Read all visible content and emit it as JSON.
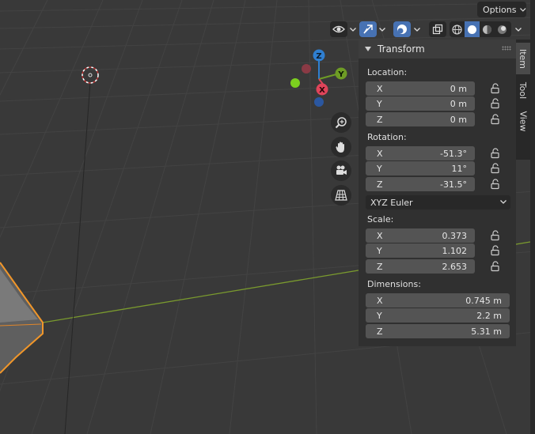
{
  "header": {
    "options_label": "Options",
    "icons": [
      "eye-visibility-icon",
      "gizmo-arrow-icon",
      "overlay-icon",
      "xray-toggle-icon",
      "shading-wireframe-icon",
      "shading-solid-icon",
      "shading-material-icon",
      "shading-rendered-icon"
    ]
  },
  "gizmo": {
    "z_label": "Z",
    "y_label": "Y",
    "x_label": "X",
    "colors": {
      "x": "#e0445a",
      "y": "#6e9c25",
      "z": "#2f7fd1"
    }
  },
  "nav_buttons": [
    "zoom-icon",
    "pan-hand-icon",
    "camera-icon",
    "grid-perspective-icon"
  ],
  "transform": {
    "title": "Transform",
    "location": {
      "label": "Location:",
      "x": {
        "axis": "X",
        "value": "0 m"
      },
      "y": {
        "axis": "Y",
        "value": "0 m"
      },
      "z": {
        "axis": "Z",
        "value": "0 m"
      }
    },
    "rotation": {
      "label": "Rotation:",
      "x": {
        "axis": "X",
        "value": "-51.3°"
      },
      "y": {
        "axis": "Y",
        "value": "11°"
      },
      "z": {
        "axis": "Z",
        "value": "-31.5°"
      },
      "mode": "XYZ Euler"
    },
    "scale": {
      "label": "Scale:",
      "x": {
        "axis": "X",
        "value": "0.373"
      },
      "y": {
        "axis": "Y",
        "value": "1.102"
      },
      "z": {
        "axis": "Z",
        "value": "2.653"
      }
    },
    "dimensions": {
      "label": "Dimensions:",
      "x": {
        "axis": "X",
        "value": "0.745 m"
      },
      "y": {
        "axis": "Y",
        "value": "2.2 m"
      },
      "z": {
        "axis": "Z",
        "value": "5.31 m"
      }
    }
  },
  "tabs": {
    "item": "Item",
    "tool": "Tool",
    "view": "View"
  },
  "colors": {
    "accent": "#4772b3",
    "selection_outline": "#f0962a",
    "x_axis_line": "#7a9a2e"
  }
}
